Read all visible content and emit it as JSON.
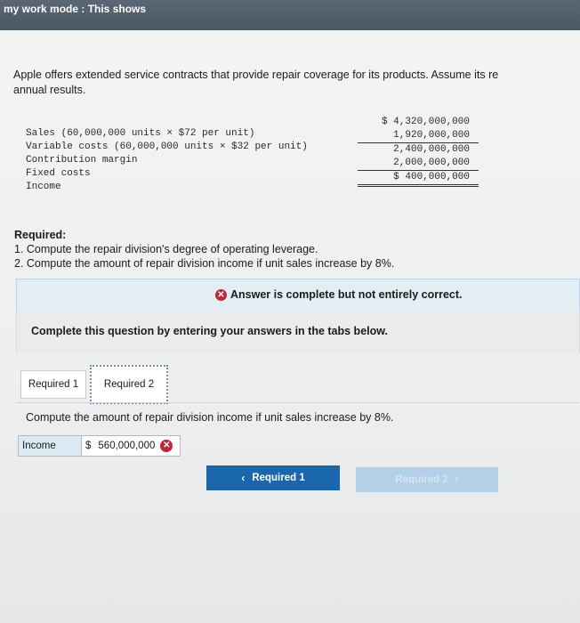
{
  "topbar": {
    "text": "my work mode : This shows"
  },
  "problem": {
    "line1": "Apple offers extended service contracts that provide repair coverage for its products. Assume its re",
    "line2": "annual results."
  },
  "statement": {
    "rows": [
      {
        "label": "Sales (60,000,000 units × $72 per unit)",
        "value": "$ 4,320,000,000"
      },
      {
        "label": "Variable costs (60,000,000 units × $32 per unit)",
        "value": "1,920,000,000"
      },
      {
        "label": "Contribution margin",
        "value": "2,400,000,000"
      },
      {
        "label": "Fixed costs",
        "value": "2,000,000,000"
      },
      {
        "label": "Income",
        "value": "$ 400,000,000"
      }
    ]
  },
  "required": {
    "header": "Required:",
    "items": [
      "1. Compute the repair division's degree of operating leverage.",
      "2. Compute the amount of repair division income if unit sales increase by 8%."
    ]
  },
  "feedback": {
    "icon": "x-circle-icon",
    "text": "Answer is complete but not entirely correct."
  },
  "panel": {
    "text": "Complete this question by entering your answers in the tabs below."
  },
  "tabs": [
    {
      "label": "Required 1"
    },
    {
      "label": "Required 2"
    }
  ],
  "instruction": "Compute the amount of repair division income if unit sales increase by 8%.",
  "answer": {
    "label": "Income",
    "currency": "$",
    "value": "560,000,000",
    "status_icon": "x-circle-icon"
  },
  "nav": {
    "prev_label": "Required 1",
    "next_label": "Required 2"
  },
  "colors": {
    "primary": "#1a67ae",
    "error": "#c0263a",
    "feedback_bg": "#e2eef4"
  }
}
